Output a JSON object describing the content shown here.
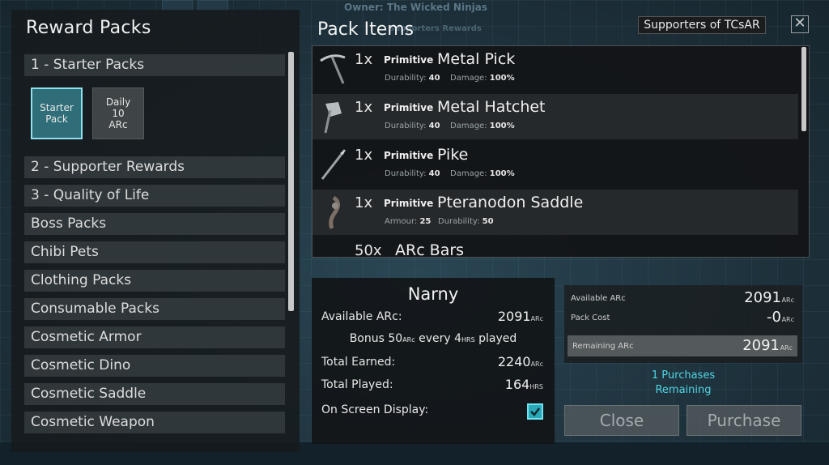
{
  "background": {
    "owner_text": "Owner: The Wicked Ninjas",
    "faded_text": "Supporters Rewards"
  },
  "left_panel": {
    "title": "Reward Packs",
    "categories": [
      {
        "label": "1 - Starter Packs",
        "expanded": true
      },
      {
        "label": "2 - Supporter Rewards"
      },
      {
        "label": "3 - Quality of Life"
      },
      {
        "label": "Boss Packs"
      },
      {
        "label": "Chibi Pets"
      },
      {
        "label": "Clothing Packs"
      },
      {
        "label": "Consumable Packs"
      },
      {
        "label": "Cosmetic Armor"
      },
      {
        "label": "Cosmetic Dino"
      },
      {
        "label": "Cosmetic Saddle"
      },
      {
        "label": "Cosmetic Weapon"
      }
    ],
    "starter_packs": [
      {
        "label": "Starter Pack",
        "selected": true
      },
      {
        "label": "Daily 10 ARc",
        "selected": false
      }
    ]
  },
  "pack_items": {
    "title": "Pack Items",
    "items": [
      {
        "qty": "1x",
        "tier": "Primitive",
        "name": "Metal Pick",
        "icon": "pick-icon",
        "stats": [
          {
            "label": "Durability:",
            "value": "40"
          },
          {
            "label": "Damage:",
            "value": "100%"
          }
        ]
      },
      {
        "qty": "1x",
        "tier": "Primitive",
        "name": "Metal Hatchet",
        "icon": "hatchet-icon",
        "stats": [
          {
            "label": "Durability:",
            "value": "40"
          },
          {
            "label": "Damage:",
            "value": "100%"
          }
        ]
      },
      {
        "qty": "1x",
        "tier": "Primitive",
        "name": "Pike",
        "icon": "pike-icon",
        "stats": [
          {
            "label": "Durability:",
            "value": "40"
          },
          {
            "label": "Damage:",
            "value": "100%"
          }
        ]
      },
      {
        "qty": "1x",
        "tier": "Primitive",
        "name": "Pteranodon Saddle",
        "icon": "saddle-icon",
        "stats": [
          {
            "label": "Armour:",
            "value": "25"
          },
          {
            "label": "Durability:",
            "value": "50"
          }
        ]
      },
      {
        "qty": "50x",
        "tier": "",
        "name": "ARc Bars",
        "icon": "bars-icon",
        "stats": []
      }
    ]
  },
  "player": {
    "name": "Narny",
    "available_label": "Available ARc:",
    "available_value": "2091",
    "unit": "ARc",
    "bonus_prefix": "Bonus",
    "bonus_amount": "50",
    "bonus_unit": "ARc",
    "bonus_mid": "every",
    "bonus_hours": "4",
    "bonus_hours_unit": "HRS",
    "bonus_suffix": "played",
    "earned_label": "Total Earned:",
    "earned_value": "2240",
    "played_label": "Total Played:",
    "played_value": "164",
    "played_unit": "HRS",
    "osd_label": "On Screen Display:",
    "osd_checked": true
  },
  "summary": {
    "available_label": "Available ARc",
    "available_value": "2091",
    "cost_label": "Pack Cost",
    "cost_value": "-0",
    "remaining_label": "Remaining ARc",
    "remaining_value": "2091",
    "unit": "ARc",
    "purchases_line1": "1 Purchases",
    "purchases_line2": "Remaining"
  },
  "buttons": {
    "close": "Close",
    "purchase": "Purchase"
  },
  "header": {
    "supporters_label": "Supporters of TCsAR",
    "close_glyph": "✕"
  },
  "colors": {
    "accent": "#4fd6e2",
    "selected_tile": "#2f6e78",
    "panel_bg": "#16191b"
  }
}
